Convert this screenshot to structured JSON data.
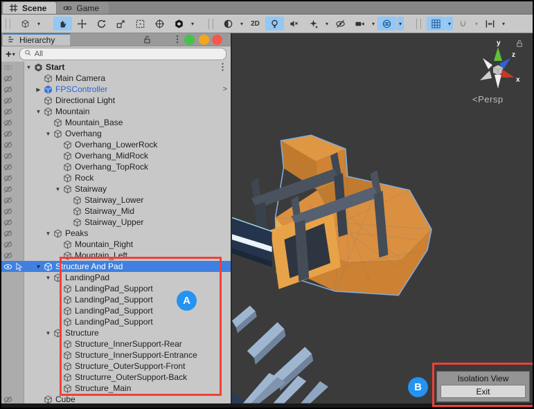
{
  "view_tabs": [
    {
      "label": "Scene",
      "icon": "scene-grid",
      "active": true
    },
    {
      "label": "Game",
      "icon": "gamepad",
      "active": false
    }
  ],
  "toolbar": {
    "groups": [
      {
        "handle": true,
        "buttons": [
          {
            "icon": "axis-cube",
            "caret": true
          }
        ]
      },
      {
        "handle": false,
        "buttons": [
          {
            "icon": "hand-tool",
            "active": true
          },
          {
            "icon": "move-tool"
          },
          {
            "icon": "rotate-tool"
          },
          {
            "icon": "scale-tool"
          },
          {
            "icon": "rect-tool"
          },
          {
            "icon": "transform-tool"
          },
          {
            "icon": "unity-logo",
            "caret": true
          }
        ]
      },
      {
        "handle": true,
        "buttons": [
          {
            "icon": "shading-sphere",
            "caret": true
          },
          {
            "icon": "mode-2d",
            "label": "2D"
          },
          {
            "icon": "light-bulb",
            "active": true
          },
          {
            "icon": "audio-speaker"
          },
          {
            "icon": "effects-star",
            "caret": true
          },
          {
            "icon": "hidden-eye"
          },
          {
            "icon": "camera",
            "caret": true
          },
          {
            "icon": "gizmo-sphere",
            "active": true,
            "caret": true,
            "caret_active": true
          }
        ]
      },
      {
        "handle": true,
        "buttons": [
          {
            "icon": "grid",
            "active": true,
            "caret": true,
            "caret_active": true
          },
          {
            "icon": "magnet",
            "disabled": true,
            "caret": true,
            "caret_disabled": true
          },
          {
            "icon": "snap-move",
            "caret": true
          }
        ]
      }
    ]
  },
  "hierarchy": {
    "tab_label": "Hierarchy",
    "lock_icon": "unlocked-padlock",
    "kebab": "⋮",
    "traffic_dots": [
      "#43C34A",
      "#F2A81D",
      "#F4584C"
    ],
    "plus_label": "+",
    "search_text": "All",
    "tree": [
      {
        "name": "Start",
        "level": 0,
        "arrow": "open",
        "icon": "scene",
        "bold": true,
        "gutter": "dim",
        "right": "kebab"
      },
      {
        "name": "Main Camera",
        "level": 1,
        "arrow": "none",
        "icon": "cube",
        "gutter": "hidden"
      },
      {
        "name": "FPSController",
        "level": 1,
        "arrow": "closed",
        "icon": "prefab",
        "color": "#2A62D9",
        "gutter": "hidden",
        "right": "chevron"
      },
      {
        "name": "Directional Light",
        "level": 1,
        "arrow": "none",
        "icon": "cube",
        "gutter": "hidden"
      },
      {
        "name": "Mountain",
        "level": 1,
        "arrow": "open",
        "icon": "cube",
        "gutter": "hidden"
      },
      {
        "name": "Mountain_Base",
        "level": 2,
        "arrow": "none",
        "icon": "cube",
        "gutter": "hidden"
      },
      {
        "name": "Overhang",
        "level": 2,
        "arrow": "open",
        "icon": "cube",
        "gutter": "hidden"
      },
      {
        "name": "Overhang_LowerRock",
        "level": 3,
        "arrow": "none",
        "icon": "cube",
        "gutter": "hidden"
      },
      {
        "name": "Overhang_MidRock",
        "level": 3,
        "arrow": "none",
        "icon": "cube",
        "gutter": "hidden"
      },
      {
        "name": "Overhang_TopRock",
        "level": 3,
        "arrow": "none",
        "icon": "cube",
        "gutter": "hidden"
      },
      {
        "name": "Rock",
        "level": 3,
        "arrow": "none",
        "icon": "cube",
        "gutter": "hidden"
      },
      {
        "name": "Stairway",
        "level": 3,
        "arrow": "open",
        "icon": "cube",
        "gutter": "hidden"
      },
      {
        "name": "Stairway_Lower",
        "level": 4,
        "arrow": "none",
        "icon": "cube",
        "gutter": "hidden"
      },
      {
        "name": "Stairway_Mid",
        "level": 4,
        "arrow": "none",
        "icon": "cube",
        "gutter": "hidden"
      },
      {
        "name": "Stairway_Upper",
        "level": 4,
        "arrow": "none",
        "icon": "cube",
        "gutter": "hidden"
      },
      {
        "name": "Peaks",
        "level": 2,
        "arrow": "open",
        "icon": "cube",
        "gutter": "hidden"
      },
      {
        "name": "Mountain_Right",
        "level": 3,
        "arrow": "none",
        "icon": "cube",
        "gutter": "hidden"
      },
      {
        "name": "Mountain_Left",
        "level": 3,
        "arrow": "none",
        "icon": "cube",
        "gutter": "hidden"
      },
      {
        "name": "Structure And Pad",
        "level": 1,
        "arrow": "open",
        "icon": "cube",
        "selected": true,
        "gutter": "visible"
      },
      {
        "name": "LandingPad",
        "level": 2,
        "arrow": "open",
        "icon": "cube",
        "gutter": "none"
      },
      {
        "name": "LandingPad_Support",
        "level": 3,
        "arrow": "none",
        "icon": "cube",
        "gutter": "none"
      },
      {
        "name": "LandingPad_Support",
        "level": 3,
        "arrow": "none",
        "icon": "cube",
        "gutter": "none"
      },
      {
        "name": "LandingPad_Support",
        "level": 3,
        "arrow": "none",
        "icon": "cube",
        "gutter": "none"
      },
      {
        "name": "LandingPad_Support",
        "level": 3,
        "arrow": "none",
        "icon": "cube",
        "gutter": "none"
      },
      {
        "name": "Structure",
        "level": 2,
        "arrow": "open",
        "icon": "cube",
        "gutter": "none"
      },
      {
        "name": "Structure_InnerSupport-Rear",
        "level": 3,
        "arrow": "none",
        "icon": "cube",
        "gutter": "none"
      },
      {
        "name": "Structure_InnerSupport-Entrance",
        "level": 3,
        "arrow": "none",
        "icon": "cube",
        "gutter": "none"
      },
      {
        "name": "Structure_OuterSupport-Front",
        "level": 3,
        "arrow": "none",
        "icon": "cube",
        "gutter": "none"
      },
      {
        "name": "Structurre_OuterSupport-Back",
        "level": 3,
        "arrow": "none",
        "icon": "cube",
        "gutter": "none"
      },
      {
        "name": "Structure_Main",
        "level": 3,
        "arrow": "none",
        "icon": "cube",
        "gutter": "none"
      },
      {
        "name": "Cube",
        "level": 1,
        "arrow": "none",
        "icon": "cube",
        "gutter": "hidden"
      }
    ]
  },
  "scene": {
    "persp_label": "Persp",
    "persp_arrow": "<",
    "axis_labels": {
      "x": "x",
      "y": "y",
      "z": "z"
    },
    "isolation": {
      "title": "Isolation View",
      "exit_label": "Exit"
    }
  },
  "badges": {
    "a": "A",
    "b": "B"
  },
  "colors": {
    "selection_blue": "#3F80E0",
    "annotation_red": "#F04038",
    "badge_blue": "#2493F2",
    "prefab_blue": "#3A7DE4",
    "scene_bg": "#3B3B3B",
    "structure_orange": "#DA9040"
  }
}
